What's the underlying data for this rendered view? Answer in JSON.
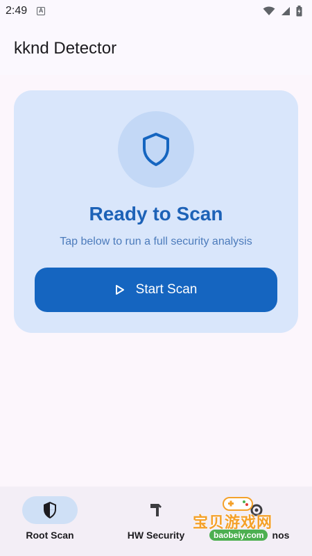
{
  "status_bar": {
    "time": "2:49",
    "notification_icon": "a-icon",
    "wifi_icon": "wifi-icon",
    "signal_icon": "signal-icon",
    "battery_icon": "battery-icon"
  },
  "app_bar": {
    "title": "kknd Detector"
  },
  "card": {
    "icon": "shield-icon",
    "title": "Ready to Scan",
    "subtitle": "Tap below to run a full security analysis",
    "button_icon": "play-icon",
    "button_label": "Start Scan"
  },
  "bottom_nav": {
    "items": [
      {
        "label": "Root Scan",
        "icon": "shield-filled-icon",
        "active": true
      },
      {
        "label": "HW Security",
        "icon": "hardware-icon",
        "active": false
      },
      {
        "label": "nos",
        "icon": "gear-icon",
        "active": false
      }
    ]
  },
  "watermark": {
    "text": "宝贝游戏网",
    "url": "baobeiy.com"
  },
  "colors": {
    "primary": "#1565c0",
    "card_bg": "#d9e6fb",
    "title_blue": "#1d62b7",
    "nav_active_pill": "#cfe0f6"
  }
}
